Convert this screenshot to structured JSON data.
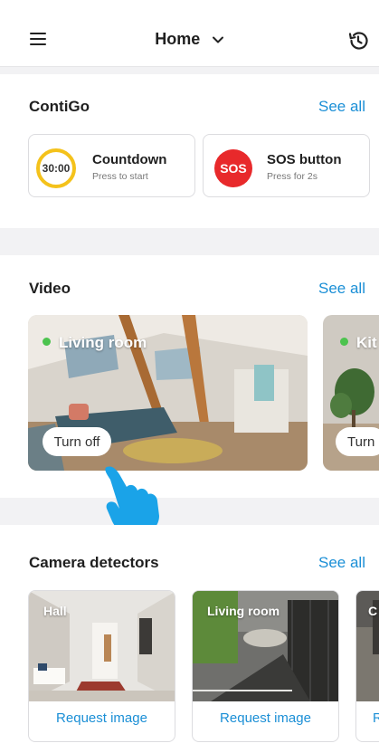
{
  "header": {
    "title": "Home"
  },
  "contigo": {
    "title": "ContiGo",
    "see_all": "See all",
    "countdown": {
      "badge": "30:00",
      "title": "Countdown",
      "subtitle": "Press to start"
    },
    "sos": {
      "badge": "SOS",
      "title": "SOS button",
      "subtitle": "Press for 2s"
    }
  },
  "video": {
    "title": "Video",
    "see_all": "See all",
    "cameras": [
      {
        "label": "Living room",
        "button": "Turn off"
      },
      {
        "label": "Kit",
        "button": "Turn"
      }
    ]
  },
  "detectors": {
    "title": "Camera detectors",
    "see_all": "See all",
    "items": [
      {
        "label": "Hall",
        "button": "Request image"
      },
      {
        "label": "Living room",
        "button": "Request image"
      },
      {
        "label": "C",
        "button": "R"
      }
    ]
  },
  "colors": {
    "accent": "#1b8fd6",
    "sos": "#e8292b",
    "timer_ring": "#f4c21b",
    "live": "#4cc34e"
  }
}
